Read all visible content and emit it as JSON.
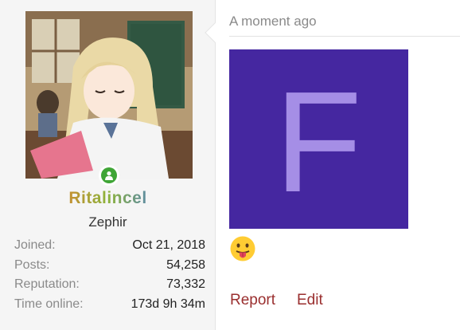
{
  "user": {
    "username": "Ritalincel",
    "title": "Zephir",
    "online_status": "online",
    "stats": [
      {
        "label": "Joined:",
        "value": "Oct 21, 2018"
      },
      {
        "label": "Posts:",
        "value": "54,258"
      },
      {
        "label": "Reputation:",
        "value": "73,332"
      },
      {
        "label": "Time online:",
        "value": "173d 9h 34m"
      }
    ]
  },
  "post": {
    "timestamp": "A moment ago",
    "image_letter": "F",
    "image_bg_color": "#4527a0",
    "image_letter_color": "#a58ee6",
    "emoji_icon": "tongue-out-emoji",
    "actions": {
      "report_label": "Report",
      "edit_label": "Edit"
    }
  },
  "colors": {
    "link": "#9a2f2f",
    "online": "#3fa536",
    "muted": "#8a8a8a"
  }
}
